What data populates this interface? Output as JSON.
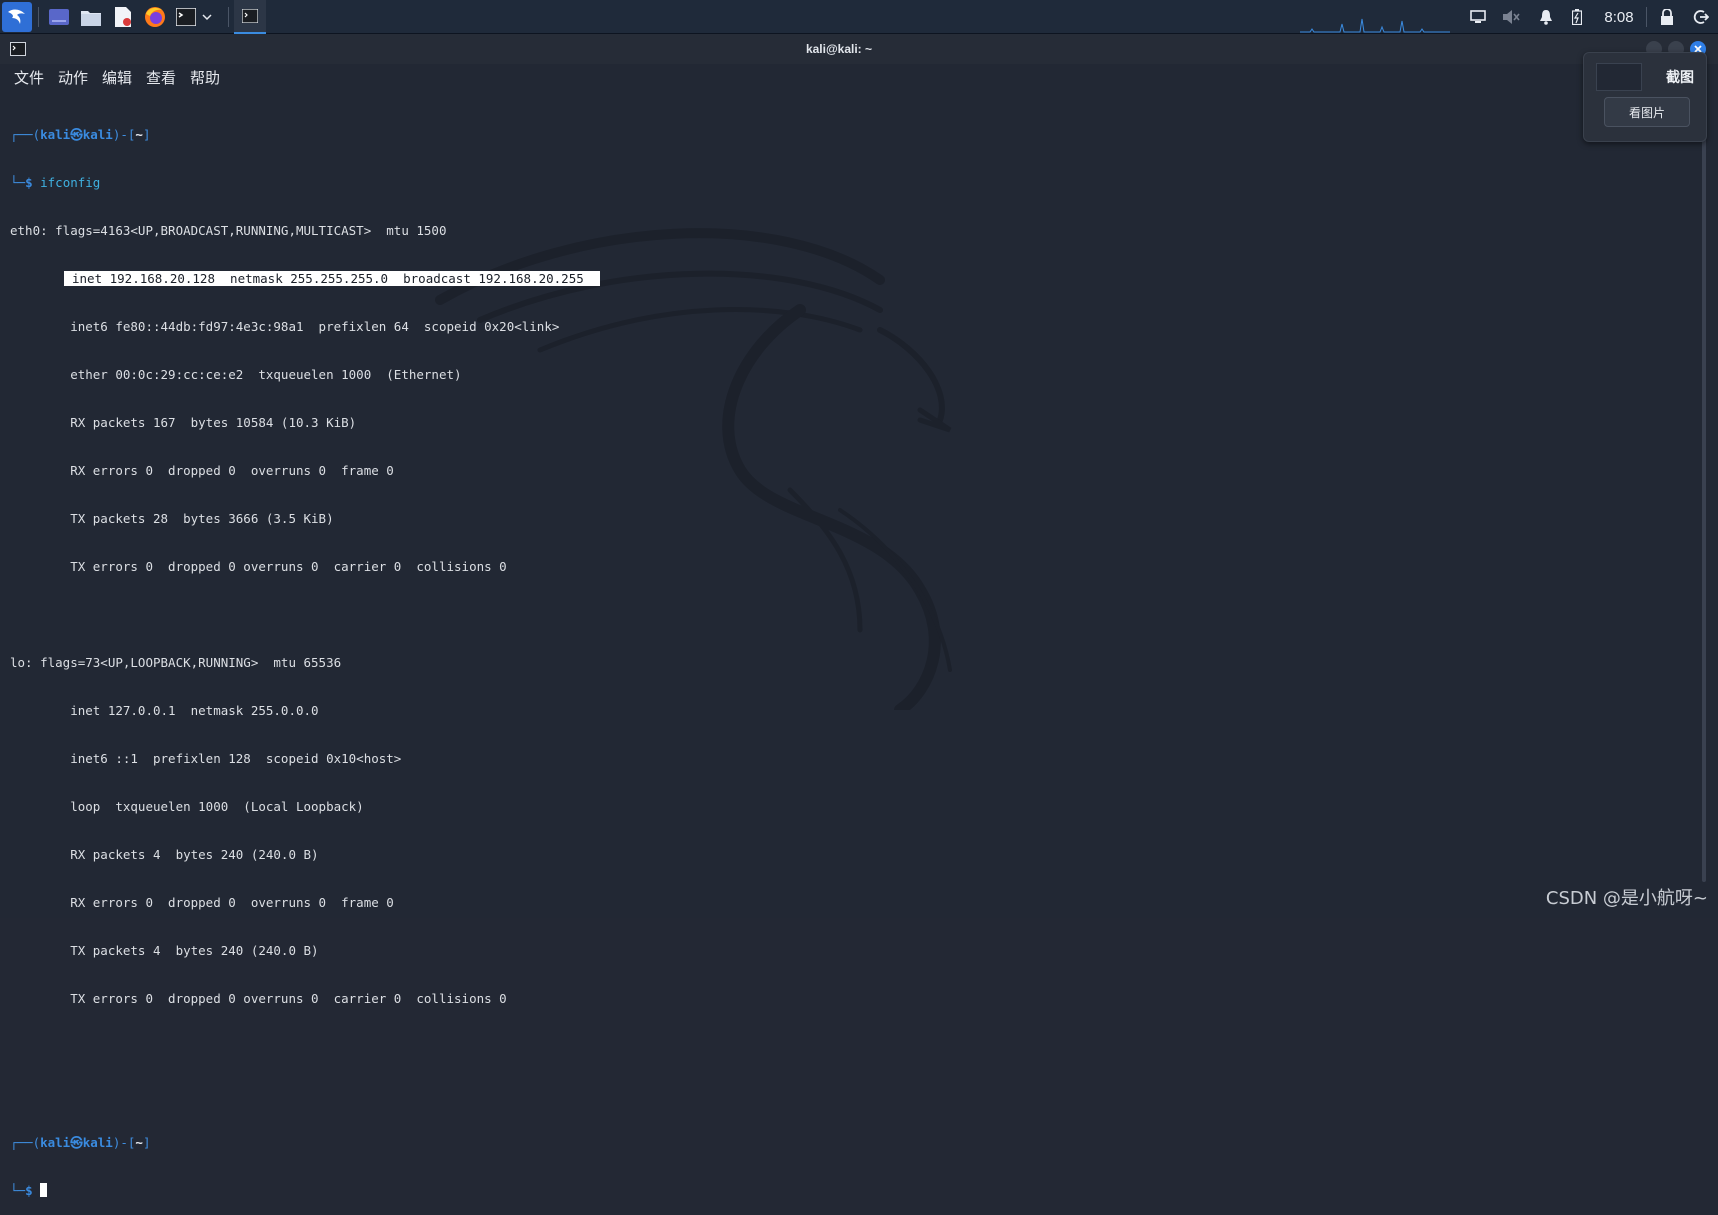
{
  "taskbar": {
    "apps": [
      {
        "name": "kali-menu-icon"
      },
      {
        "name": "desktop-icon"
      },
      {
        "name": "file-manager-icon"
      },
      {
        "name": "text-editor-icon"
      },
      {
        "name": "firefox-icon"
      },
      {
        "name": "terminal-icon"
      },
      {
        "name": "chevron-down-icon"
      }
    ],
    "clock": "8:08"
  },
  "window": {
    "title": "kali@kali: ~",
    "menu": [
      "文件",
      "动作",
      "编辑",
      "查看",
      "帮助"
    ]
  },
  "terminal": {
    "prompt": {
      "open": "┌──(",
      "user": "kali",
      "at": "㉿",
      "host": "kali",
      "mid": ")-[",
      "cwd": "~",
      "close": "]",
      "second": "└─",
      "dollar": "$"
    },
    "command": "ifconfig",
    "output": [
      "eth0: flags=4163<UP,BROADCAST,RUNNING,MULTICAST>  mtu 1500",
      "inet 192.168.20.128  netmask 255.255.255.0  broadcast 192.168.20.255",
      "        inet6 fe80::44db:fd97:4e3c:98a1  prefixlen 64  scopeid 0x20<link>",
      "        ether 00:0c:29:cc:ce:e2  txqueuelen 1000  (Ethernet)",
      "        RX packets 167  bytes 10584 (10.3 KiB)",
      "        RX errors 0  dropped 0  overruns 0  frame 0",
      "        TX packets 28  bytes 3666 (3.5 KiB)",
      "        TX errors 0  dropped 0 overruns 0  carrier 0  collisions 0",
      "",
      "lo: flags=73<UP,LOOPBACK,RUNNING>  mtu 65536",
      "        inet 127.0.0.1  netmask 255.0.0.0",
      "        inet6 ::1  prefixlen 128  scopeid 0x10<host>",
      "        loop  txqueuelen 1000  (Local Loopback)",
      "        RX packets 4  bytes 240 (240.0 B)",
      "        RX errors 0  dropped 0  overruns 0  frame 0",
      "        TX packets 4  bytes 240 (240.0 B)",
      "        TX errors 0  dropped 0 overruns 0  carrier 0  collisions 0"
    ]
  },
  "screenshot_popup": {
    "title": "截图",
    "button": "看图片"
  },
  "watermark": "CSDN @是小航呀~",
  "colors": {
    "background": "#232834",
    "prompt_blue": "#3a8be0",
    "highlight": "#ffffff"
  }
}
